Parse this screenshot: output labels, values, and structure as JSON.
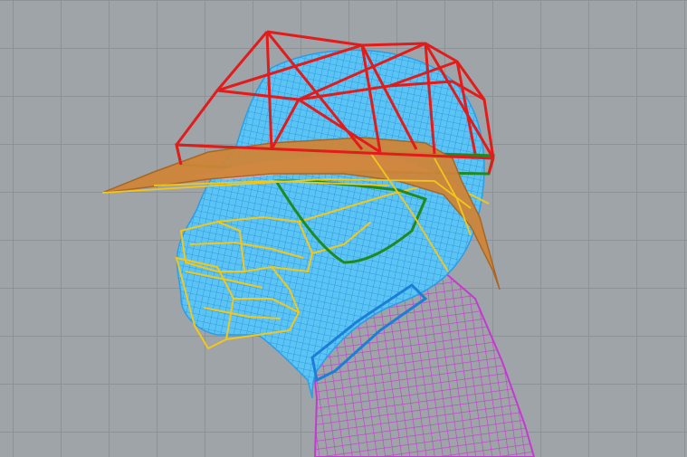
{
  "viewport": {
    "background": "#9ea4a8",
    "grid_color": "#8c9296"
  },
  "model": {
    "head_color": "#4fb8ee",
    "neck_color": "#c43ad0",
    "cap_crown_color": "#e21b1b",
    "cap_band_color": "#1f8a1f",
    "visor_color": "#cf8538",
    "yellow_color": "#f2c71a",
    "pink_color": "#f2b8d8",
    "blue_dark_color": "#1c7fd6"
  }
}
